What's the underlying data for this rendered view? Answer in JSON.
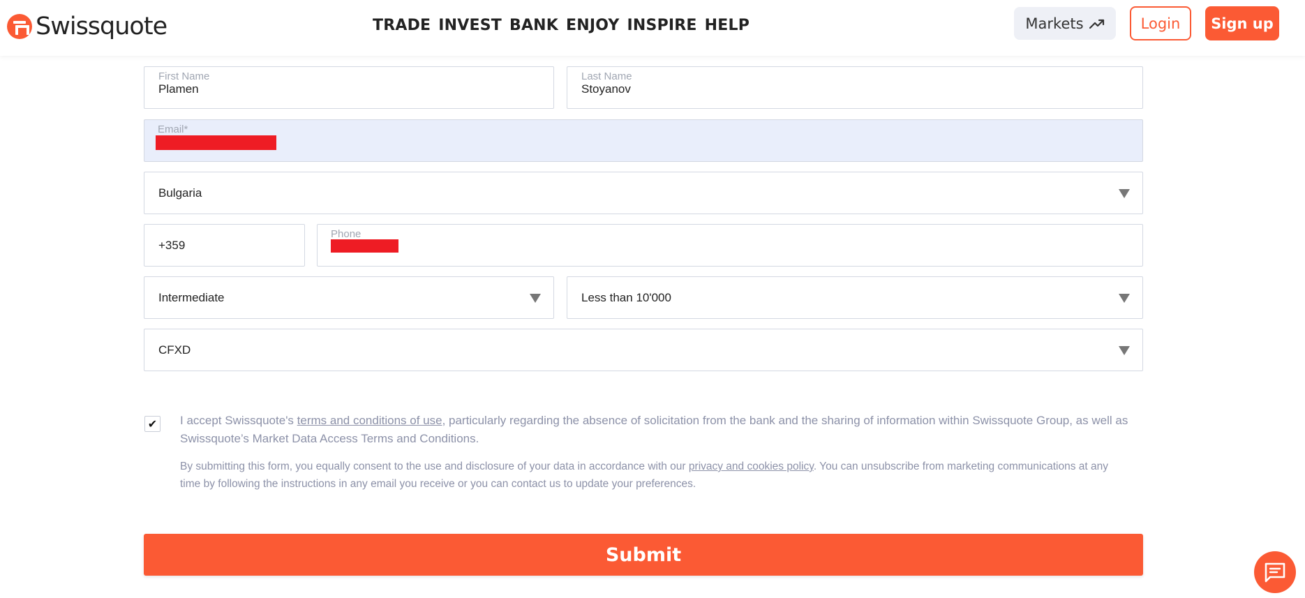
{
  "header": {
    "logo_text": "Swissquote",
    "nav": [
      "TRADE",
      "INVEST",
      "BANK",
      "ENJOY",
      "INSPIRE",
      "HELP"
    ],
    "markets_label": "Markets",
    "login_label": "Login",
    "signup_label": "Sign up"
  },
  "form": {
    "first_name": {
      "label": "First Name",
      "value": "Plamen"
    },
    "last_name": {
      "label": "Last Name",
      "value": "Stoyanov"
    },
    "email": {
      "label": "Email*",
      "value": ""
    },
    "country": {
      "value": "Bulgaria"
    },
    "phone_code": {
      "value": "+359"
    },
    "phone": {
      "label": "Phone",
      "value": ""
    },
    "experience": {
      "value": "Intermediate"
    },
    "amount": {
      "value": "Less than 10'000"
    },
    "product": {
      "value": "CFXD"
    }
  },
  "consent": {
    "checked_mark": "✔",
    "text_before": "I accept Swissquote's ",
    "link": "terms and conditions of use",
    "text_after": ", particularly regarding the absence of solicitation from the bank and the sharing of information within Swissquote Group, as well as Swissquote’s Market Data Access Terms and Conditions."
  },
  "notice": {
    "text_before": "By submitting this form, you equally consent to the use and disclosure of your data in accordance with our ",
    "link": "privacy and cookies policy",
    "text_after": ". You can unsubscribe from marketing communications at any time by following the instructions in any email you receive or you can contact us to update your preferences."
  },
  "submit_label": "Submit",
  "colors": {
    "brand": "#fb5a34",
    "email_bg": "#e9eefb",
    "redaction": "#ee1c24",
    "muted_text": "#8c91a8"
  }
}
